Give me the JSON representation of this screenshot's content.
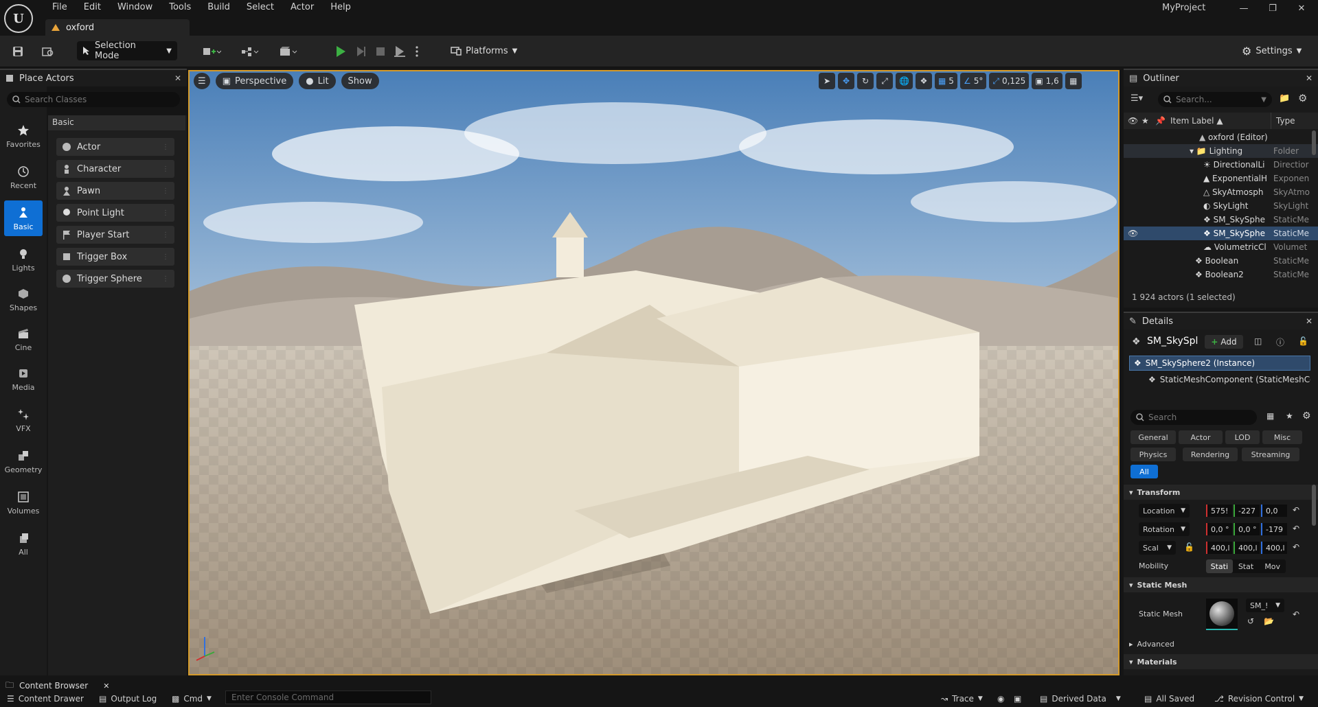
{
  "app": {
    "project": "MyProject",
    "level_tab": "oxford"
  },
  "menu": [
    "File",
    "Edit",
    "Window",
    "Tools",
    "Build",
    "Select",
    "Actor",
    "Help"
  ],
  "toolbar": {
    "selection_mode": "Selection Mode",
    "platforms": "Platforms",
    "settings": "Settings"
  },
  "place_actors": {
    "title": "Place Actors",
    "search_placeholder": "Search Classes",
    "category_header": "Basic",
    "categories": [
      "Favorites",
      "Recent",
      "Basic",
      "Lights",
      "Shapes",
      "Cine",
      "Media",
      "VFX",
      "Geometry",
      "Volumes",
      "All"
    ],
    "active_category": "Basic",
    "actors": [
      "Actor",
      "Character",
      "Pawn",
      "Point Light",
      "Player Start",
      "Trigger Box",
      "Trigger Sphere"
    ]
  },
  "viewport": {
    "perspective": "Perspective",
    "lit": "Lit",
    "show": "Show",
    "grid_snap": "5",
    "angle_snap": "5°",
    "scale_snap": "0,125",
    "camera_speed": "1,6"
  },
  "outliner": {
    "title": "Outliner",
    "search_placeholder": "Search...",
    "col_label": "Item Label ▲",
    "col_type": "Type",
    "rows": [
      {
        "label": "oxford (Editor)",
        "type": ""
      },
      {
        "label": "Lighting",
        "type": "Folder"
      },
      {
        "label": "DirectionalLi",
        "type": "Directior"
      },
      {
        "label": "ExponentialH",
        "type": "Exponen"
      },
      {
        "label": "SkyAtmosph",
        "type": "SkyAtmo"
      },
      {
        "label": "SkyLight",
        "type": "SkyLight"
      },
      {
        "label": "SM_SkySphe",
        "type": "StaticMe"
      },
      {
        "label": "SM_SkySphe",
        "type": "StaticMe"
      },
      {
        "label": "VolumetricCl",
        "type": "Volumet"
      },
      {
        "label": "Boolean",
        "type": "StaticMe"
      },
      {
        "label": "Boolean2",
        "type": "StaticMe"
      }
    ],
    "selected_row": 7,
    "actor_count": "1 924 actors (1 selected)"
  },
  "details": {
    "title": "Details",
    "actor_name": "SM_SkySpl",
    "add_label": "Add",
    "instance": "SM_SkySphere2 (Instance)",
    "component": "StaticMeshComponent (StaticMeshCo",
    "search_placeholder": "Search",
    "filters_row1": [
      "General",
      "Actor",
      "LOD",
      "Misc"
    ],
    "filters_row2": [
      "Physics",
      "Rendering",
      "Streaming"
    ],
    "filter_all": "All",
    "section_transform": "Transform",
    "location_label": "Location",
    "location": [
      "575!",
      "-227",
      "0,0"
    ],
    "rotation_label": "Rotation",
    "rotation": [
      "0,0 °",
      "0,0 °",
      "-179"
    ],
    "scale_label": "Scal",
    "scale": [
      "400,l",
      "400,l",
      "400,l"
    ],
    "mobility_label": "Mobility",
    "mobility": [
      "Stati",
      "Stat",
      "Mov"
    ],
    "section_static_mesh": "Static Mesh",
    "static_mesh_label": "Static Mesh",
    "static_mesh_value": "SM_!",
    "section_advanced": "Advanced",
    "section_materials": "Materials"
  },
  "statusbar": {
    "content_browser": "Content Browser",
    "content_drawer": "Content Drawer",
    "output_log": "Output Log",
    "cmd": "Cmd",
    "console_placeholder": "Enter Console Command",
    "trace": "Trace",
    "derived_data": "Derived Data",
    "all_saved": "All Saved",
    "revision_control": "Revision Control"
  },
  "colors": {
    "accent": "#0f6fd4",
    "viewport_border": "#d49a2a",
    "play": "#3cb043"
  }
}
